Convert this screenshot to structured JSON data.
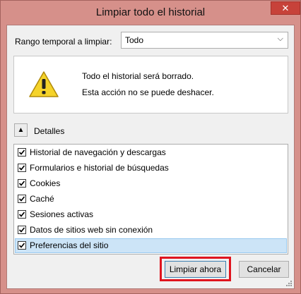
{
  "window": {
    "title": "Limpiar todo el historial",
    "close_glyph": "✕"
  },
  "range": {
    "label": "Rango temporal a limpiar:",
    "selected": "Todo"
  },
  "warning": {
    "icon": "warning-icon",
    "line1": "Todo el historial será borrado.",
    "line2": "Esta acción no se puede deshacer."
  },
  "details": {
    "label": "Detalles",
    "expanded": true
  },
  "items": [
    {
      "label": "Historial de navegación y descargas",
      "checked": true
    },
    {
      "label": "Formularios e historial de búsquedas",
      "checked": true
    },
    {
      "label": "Cookies",
      "checked": true
    },
    {
      "label": "Caché",
      "checked": true
    },
    {
      "label": "Sesiones activas",
      "checked": true
    },
    {
      "label": "Datos de sitios web sin conexión",
      "checked": true
    },
    {
      "label": "Preferencias del sitio",
      "checked": true,
      "selected": true
    }
  ],
  "buttons": {
    "clear_now": "Limpiar ahora",
    "cancel": "Cancelar"
  },
  "colors": {
    "frame": "#d6908a",
    "close": "#c7423a",
    "highlight": "#e0141e",
    "selection": "#cce4f7"
  }
}
